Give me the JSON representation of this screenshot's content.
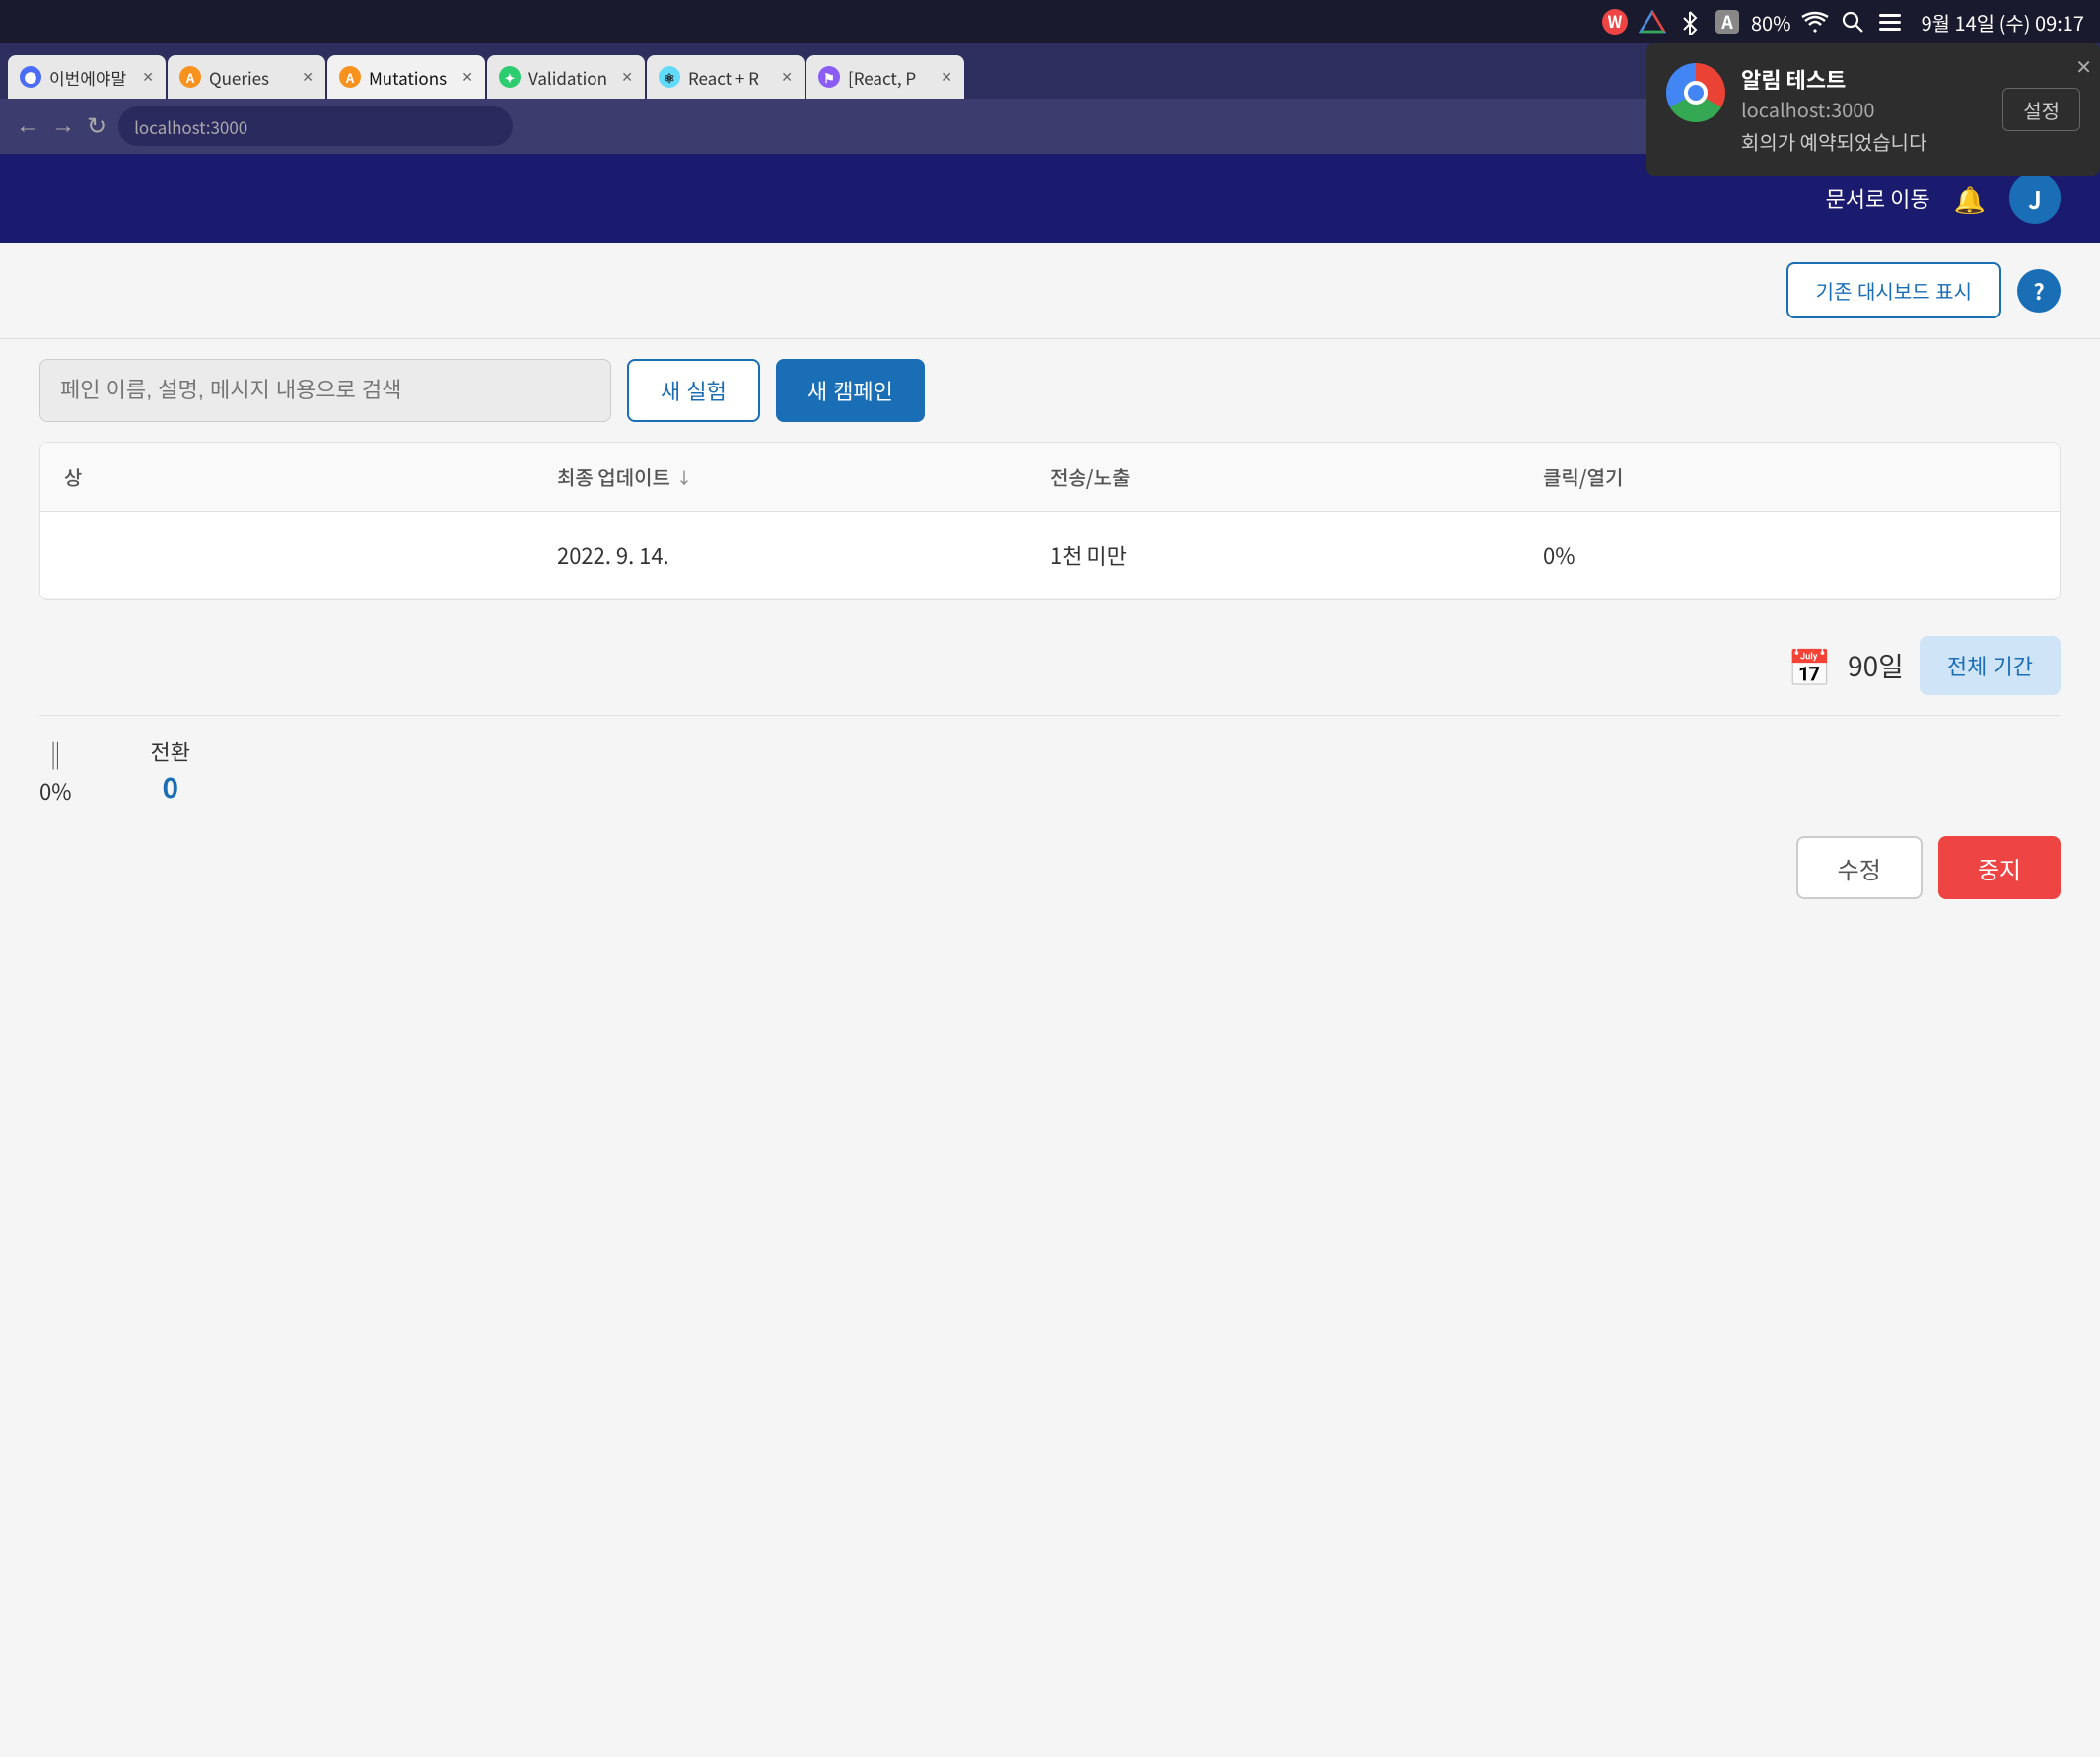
{
  "systemBar": {
    "batteryPct": "80%",
    "datetime": "9월 14일 (수) 09:17"
  },
  "tabs": [
    {
      "id": "tab1",
      "label": "이번에야말",
      "faviconType": "blue",
      "faviconLetter": "●",
      "active": false,
      "closable": true
    },
    {
      "id": "tab2",
      "label": "Queries",
      "faviconType": "orange",
      "faviconLetter": "A",
      "active": false,
      "closable": true
    },
    {
      "id": "tab3",
      "label": "Mutations",
      "faviconType": "orange",
      "faviconLetter": "A",
      "active": true,
      "closable": true
    },
    {
      "id": "tab4",
      "label": "Validation",
      "faviconType": "green",
      "faviconLetter": "✦",
      "active": false,
      "closable": true
    },
    {
      "id": "tab5",
      "label": "React + R",
      "faviconType": "react",
      "faviconLetter": "⚛",
      "active": false,
      "closable": true
    },
    {
      "id": "tab6",
      "label": "[React, P",
      "faviconType": "purple",
      "faviconLetter": "⚑",
      "active": false,
      "closable": true
    }
  ],
  "header": {
    "goToDocsLabel": "문서로 이동",
    "avatarLetter": "J"
  },
  "subToolbar": {
    "dashboardBtnLabel": "기존 대시보드 표시",
    "helpLabel": "?"
  },
  "searchBar": {
    "placeholder": "페인 이름, 설명, 메시지 내용으로 검색",
    "newExperimentLabel": "새 실험",
    "newCampaignLabel": "새 캠페인"
  },
  "table": {
    "headers": [
      {
        "label": "상",
        "sortable": false
      },
      {
        "label": "최종 업데이트",
        "sortable": true
      },
      {
        "label": "전송/노출",
        "sortable": false
      },
      {
        "label": "클릭/열기",
        "sortable": false
      }
    ],
    "rows": [
      {
        "name": "",
        "lastUpdated": "2022. 9. 14.",
        "sendExposure": "1천 미만",
        "clickOpen": "0%"
      }
    ]
  },
  "dateFilter": {
    "days": "90일",
    "allPeriodLabel": "전체 기간"
  },
  "stats": {
    "conversionLabel": "전환",
    "conversionValue": "0",
    "conversionPct": "0%"
  },
  "bottomButtons": {
    "editLabel": "수정",
    "stopLabel": "중지"
  },
  "notification": {
    "title": "알림 테스트",
    "url": "localhost:3000",
    "message": "회의가 예약되었습니다",
    "settingsLabel": "설정",
    "closeLabel": "✕"
  }
}
